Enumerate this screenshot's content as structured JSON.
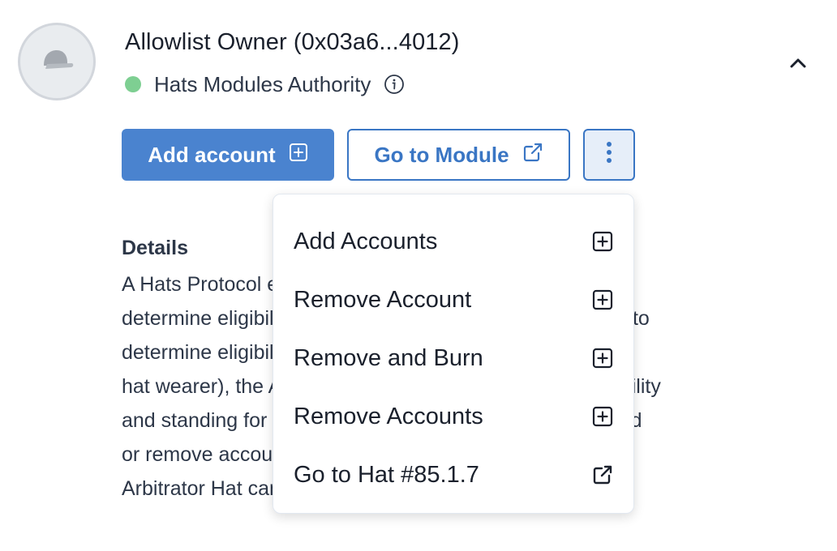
{
  "header": {
    "title": "Allowlist Owner (0x03a6...4012)",
    "authority_label": "Hats Modules Authority",
    "status_color": "#7ecf92",
    "avatar_icon": "cap-icon",
    "info_icon": "info-icon",
    "collapse_icon": "chevron-up-icon"
  },
  "actions": {
    "add_account_label": "Add account",
    "add_account_icon": "plus-square-icon",
    "go_to_module_label": "Go to Module",
    "go_to_module_icon": "external-link-icon",
    "more_icon": "kebab-menu-icon",
    "accent_color": "#4a83cf"
  },
  "details": {
    "heading": "Details",
    "lines": [
      "A Hats Protocol eligibility module that uses an allowlist to",
      "determine eligibility. The owner can manage the allowlist to",
      "determine eligibility. For each account (i.e., potential",
      "hat wearer), the Arbitrator Hat can set an account's eligibility",
      "and standing for this hat. The Allowlist Owner Hat can add",
      "or remove accounts from the list. The wearer(s) of the",
      "Arbitrator Hat can put accounts in bad standing."
    ]
  },
  "menu": {
    "items": [
      {
        "label": "Add Accounts",
        "icon": "plus-square-icon"
      },
      {
        "label": "Remove Account",
        "icon": "plus-square-icon"
      },
      {
        "label": "Remove and Burn",
        "icon": "plus-square-icon"
      },
      {
        "label": "Remove Accounts",
        "icon": "plus-square-icon"
      },
      {
        "label": "Go to Hat #85.1.7",
        "icon": "external-link-icon"
      }
    ]
  }
}
